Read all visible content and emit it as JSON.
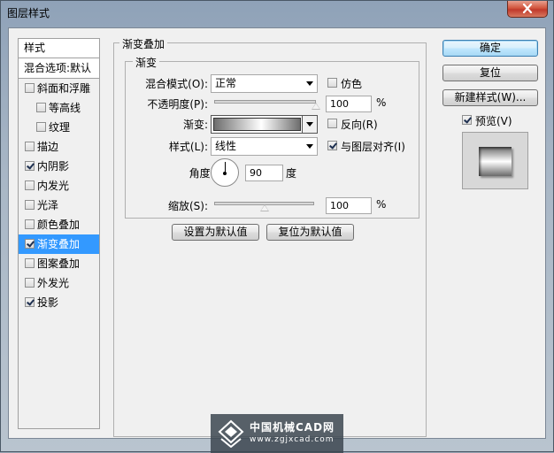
{
  "window": {
    "title": "图层样式"
  },
  "style_list": {
    "header": "样式",
    "blend_header": "混合选项:默认",
    "items": [
      {
        "label": "斜面和浮雕",
        "checked": false,
        "indent": false,
        "selected": false
      },
      {
        "label": "等高线",
        "checked": false,
        "indent": true,
        "selected": false
      },
      {
        "label": "纹理",
        "checked": false,
        "indent": true,
        "selected": false
      },
      {
        "label": "描边",
        "checked": false,
        "indent": false,
        "selected": false
      },
      {
        "label": "内阴影",
        "checked": true,
        "indent": false,
        "selected": false
      },
      {
        "label": "内发光",
        "checked": false,
        "indent": false,
        "selected": false
      },
      {
        "label": "光泽",
        "checked": false,
        "indent": false,
        "selected": false
      },
      {
        "label": "颜色叠加",
        "checked": false,
        "indent": false,
        "selected": false
      },
      {
        "label": "渐变叠加",
        "checked": true,
        "indent": false,
        "selected": true
      },
      {
        "label": "图案叠加",
        "checked": false,
        "indent": false,
        "selected": false
      },
      {
        "label": "外发光",
        "checked": false,
        "indent": false,
        "selected": false
      },
      {
        "label": "投影",
        "checked": true,
        "indent": false,
        "selected": false
      }
    ]
  },
  "panel": {
    "outer_title": "渐变叠加",
    "inner_title": "渐变",
    "blend_mode_label": "混合模式(O):",
    "blend_mode_value": "正常",
    "dither_label": "仿色",
    "opacity_label": "不透明度(P):",
    "opacity_value": "100",
    "opacity_fraction": 1.0,
    "percent": "%",
    "gradient_label": "渐变:",
    "reverse_label": "反向(R)",
    "style_label": "样式(L):",
    "style_value": "线性",
    "align_label": "与图层对齐(I)",
    "angle_label": "角度(N):",
    "angle_value": "90",
    "degree": "度",
    "scale_label": "缩放(S):",
    "scale_value": "100",
    "scale_fraction": 0.5,
    "make_default": "设置为默认值",
    "reset_default": "复位为默认值"
  },
  "checkbox_state": {
    "dither": false,
    "reverse": false,
    "align": true,
    "preview": true
  },
  "buttons": {
    "ok": "确定",
    "reset": "复位",
    "new_style": "新建样式(W)...",
    "preview_label": "预览(V)"
  },
  "watermark": {
    "line1": "中国机械CAD网",
    "line2": "www.zgjxcad.com"
  },
  "colors": {
    "selection": "#3399ff",
    "dialog_bg": "#f0f0f0",
    "close_button": "#c0392b"
  }
}
